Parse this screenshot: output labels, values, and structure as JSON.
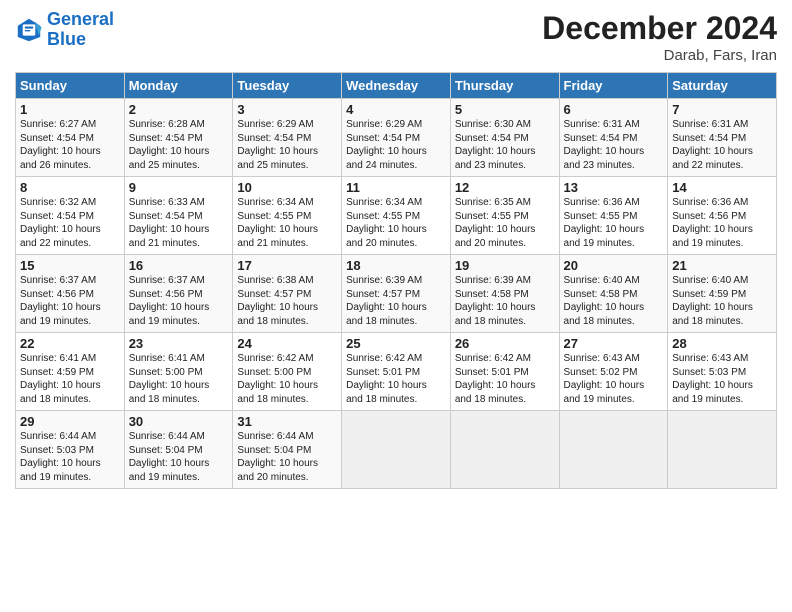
{
  "logo": {
    "line1": "General",
    "line2": "Blue"
  },
  "title": "December 2024",
  "subtitle": "Darab, Fars, Iran",
  "days_header": [
    "Sunday",
    "Monday",
    "Tuesday",
    "Wednesday",
    "Thursday",
    "Friday",
    "Saturday"
  ],
  "weeks": [
    [
      {
        "num": "1",
        "rise": "6:27 AM",
        "set": "4:54 PM",
        "daylight": "10 hours and 26 minutes."
      },
      {
        "num": "2",
        "rise": "6:28 AM",
        "set": "4:54 PM",
        "daylight": "10 hours and 25 minutes."
      },
      {
        "num": "3",
        "rise": "6:29 AM",
        "set": "4:54 PM",
        "daylight": "10 hours and 25 minutes."
      },
      {
        "num": "4",
        "rise": "6:29 AM",
        "set": "4:54 PM",
        "daylight": "10 hours and 24 minutes."
      },
      {
        "num": "5",
        "rise": "6:30 AM",
        "set": "4:54 PM",
        "daylight": "10 hours and 23 minutes."
      },
      {
        "num": "6",
        "rise": "6:31 AM",
        "set": "4:54 PM",
        "daylight": "10 hours and 23 minutes."
      },
      {
        "num": "7",
        "rise": "6:31 AM",
        "set": "4:54 PM",
        "daylight": "10 hours and 22 minutes."
      }
    ],
    [
      {
        "num": "8",
        "rise": "6:32 AM",
        "set": "4:54 PM",
        "daylight": "10 hours and 22 minutes."
      },
      {
        "num": "9",
        "rise": "6:33 AM",
        "set": "4:54 PM",
        "daylight": "10 hours and 21 minutes."
      },
      {
        "num": "10",
        "rise": "6:34 AM",
        "set": "4:55 PM",
        "daylight": "10 hours and 21 minutes."
      },
      {
        "num": "11",
        "rise": "6:34 AM",
        "set": "4:55 PM",
        "daylight": "10 hours and 20 minutes."
      },
      {
        "num": "12",
        "rise": "6:35 AM",
        "set": "4:55 PM",
        "daylight": "10 hours and 20 minutes."
      },
      {
        "num": "13",
        "rise": "6:36 AM",
        "set": "4:55 PM",
        "daylight": "10 hours and 19 minutes."
      },
      {
        "num": "14",
        "rise": "6:36 AM",
        "set": "4:56 PM",
        "daylight": "10 hours and 19 minutes."
      }
    ],
    [
      {
        "num": "15",
        "rise": "6:37 AM",
        "set": "4:56 PM",
        "daylight": "10 hours and 19 minutes."
      },
      {
        "num": "16",
        "rise": "6:37 AM",
        "set": "4:56 PM",
        "daylight": "10 hours and 19 minutes."
      },
      {
        "num": "17",
        "rise": "6:38 AM",
        "set": "4:57 PM",
        "daylight": "10 hours and 18 minutes."
      },
      {
        "num": "18",
        "rise": "6:39 AM",
        "set": "4:57 PM",
        "daylight": "10 hours and 18 minutes."
      },
      {
        "num": "19",
        "rise": "6:39 AM",
        "set": "4:58 PM",
        "daylight": "10 hours and 18 minutes."
      },
      {
        "num": "20",
        "rise": "6:40 AM",
        "set": "4:58 PM",
        "daylight": "10 hours and 18 minutes."
      },
      {
        "num": "21",
        "rise": "6:40 AM",
        "set": "4:59 PM",
        "daylight": "10 hours and 18 minutes."
      }
    ],
    [
      {
        "num": "22",
        "rise": "6:41 AM",
        "set": "4:59 PM",
        "daylight": "10 hours and 18 minutes."
      },
      {
        "num": "23",
        "rise": "6:41 AM",
        "set": "5:00 PM",
        "daylight": "10 hours and 18 minutes."
      },
      {
        "num": "24",
        "rise": "6:42 AM",
        "set": "5:00 PM",
        "daylight": "10 hours and 18 minutes."
      },
      {
        "num": "25",
        "rise": "6:42 AM",
        "set": "5:01 PM",
        "daylight": "10 hours and 18 minutes."
      },
      {
        "num": "26",
        "rise": "6:42 AM",
        "set": "5:01 PM",
        "daylight": "10 hours and 18 minutes."
      },
      {
        "num": "27",
        "rise": "6:43 AM",
        "set": "5:02 PM",
        "daylight": "10 hours and 19 minutes."
      },
      {
        "num": "28",
        "rise": "6:43 AM",
        "set": "5:03 PM",
        "daylight": "10 hours and 19 minutes."
      }
    ],
    [
      {
        "num": "29",
        "rise": "6:44 AM",
        "set": "5:03 PM",
        "daylight": "10 hours and 19 minutes."
      },
      {
        "num": "30",
        "rise": "6:44 AM",
        "set": "5:04 PM",
        "daylight": "10 hours and 19 minutes."
      },
      {
        "num": "31",
        "rise": "6:44 AM",
        "set": "5:04 PM",
        "daylight": "10 hours and 20 minutes."
      },
      null,
      null,
      null,
      null
    ]
  ]
}
